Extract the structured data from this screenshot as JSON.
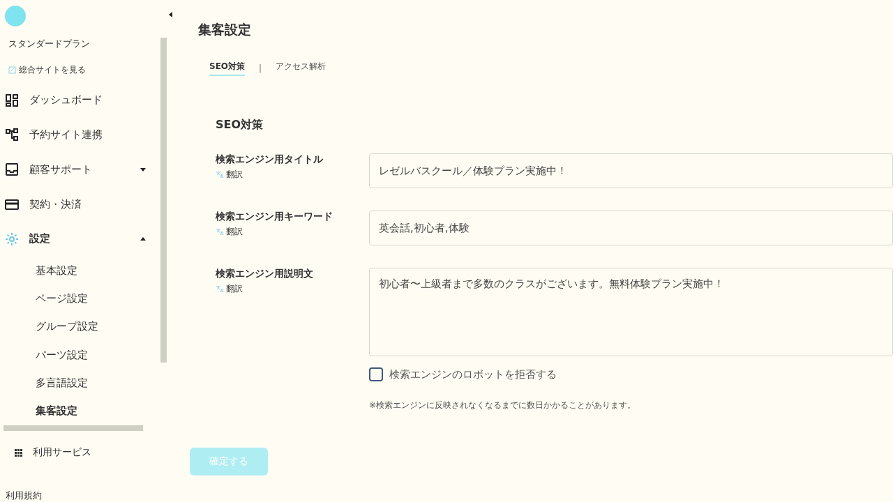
{
  "sidebar": {
    "plan": "スタンダードプラン",
    "site_link": "総合サイトを見る",
    "items": [
      {
        "label": "ダッシュボード",
        "kind": "link",
        "selected": false
      },
      {
        "label": "予約サイト連携",
        "kind": "link",
        "selected": false
      },
      {
        "label": "顧客サポート",
        "kind": "group",
        "expanded": false,
        "selected": false
      },
      {
        "label": "契約・決済",
        "kind": "link",
        "selected": false
      },
      {
        "label": "設定",
        "kind": "group",
        "expanded": true,
        "selected": true,
        "children": [
          {
            "label": "基本設定",
            "selected": false
          },
          {
            "label": "ページ設定",
            "selected": false
          },
          {
            "label": "グループ設定",
            "selected": false
          },
          {
            "label": "パーツ設定",
            "selected": false
          },
          {
            "label": "多言語設定",
            "selected": false
          },
          {
            "label": "集客設定",
            "selected": true
          }
        ]
      }
    ],
    "services": "利用サービス",
    "terms": "利用規約"
  },
  "page": {
    "title": "集客設定",
    "tabs": [
      {
        "label": "SEO対策",
        "selected": true
      },
      {
        "label": "アクセス解析",
        "selected": false
      }
    ],
    "tab_separator": "|",
    "section_title": "SEO対策",
    "fields": [
      {
        "label": "検索エンジン用タイトル",
        "translate": "翻訳",
        "kind": "input",
        "value": "レゼルバスクール／体験プラン実施中！"
      },
      {
        "label": "検索エンジン用キーワード",
        "translate": "翻訳",
        "kind": "input",
        "value": "英会話,初心者,体験"
      },
      {
        "label": "検索エンジン用説明文",
        "translate": "翻訳",
        "kind": "textarea",
        "value": "初心者〜上級者まで多数のクラスがございます。無料体験プラン実施中！"
      }
    ],
    "robots": {
      "label": "検索エンジンのロボットを拒否する",
      "checked": false
    },
    "note": "※検索エンジンに反映されなくなるまでに数日かかることがあります。",
    "submit": {
      "label": "確定する",
      "disabled": true
    }
  }
}
